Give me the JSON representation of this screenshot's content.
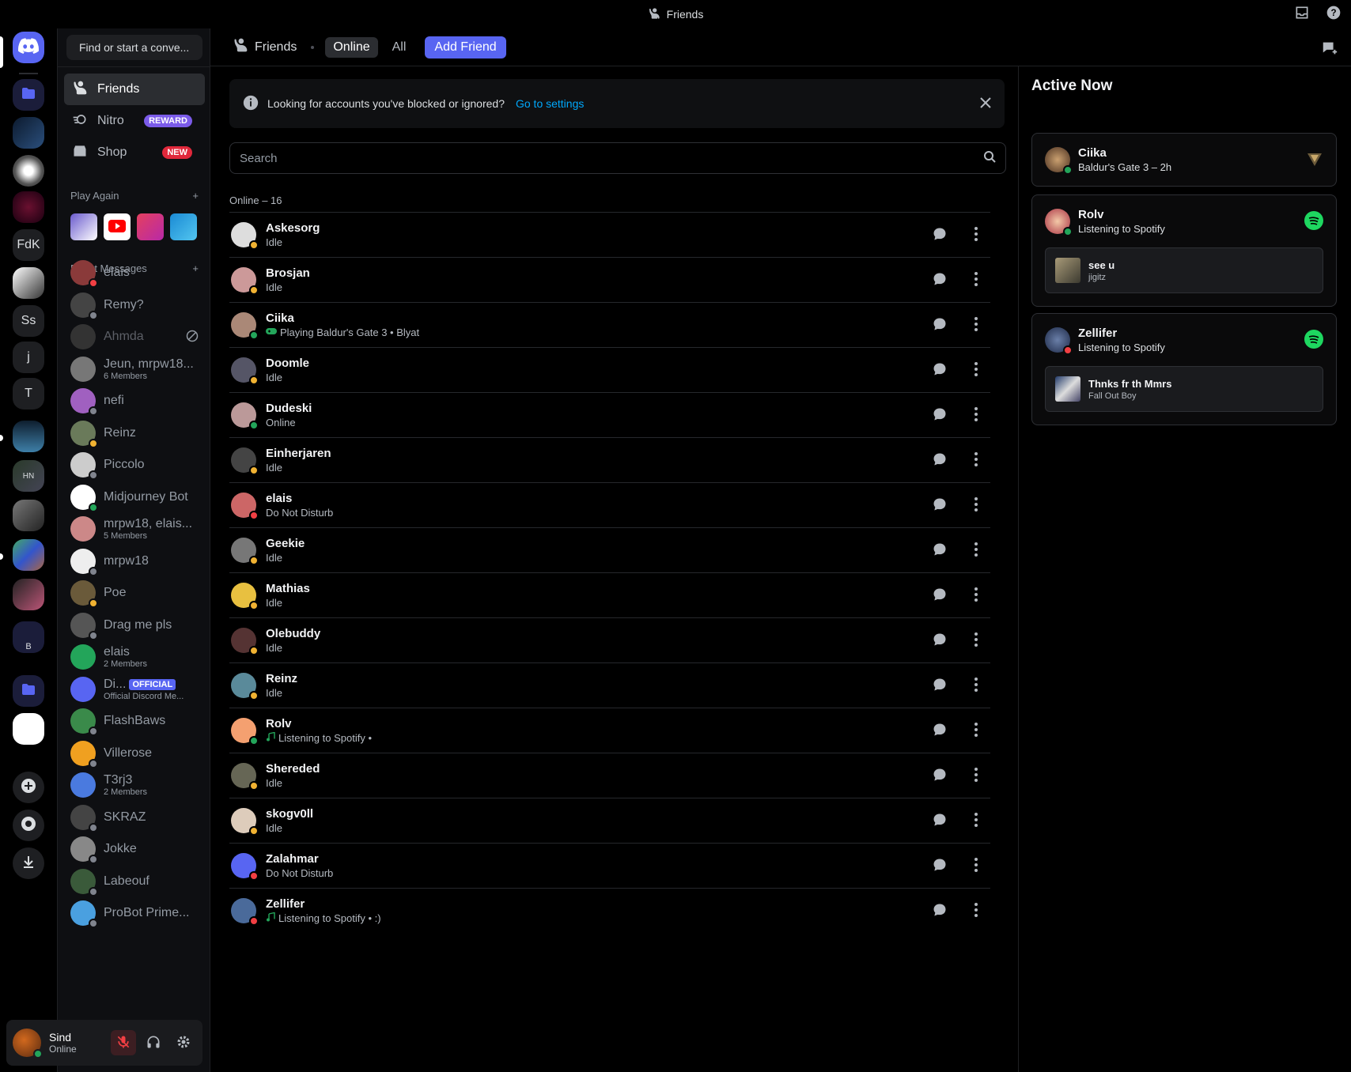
{
  "window": {
    "title": "Friends"
  },
  "servers": {
    "labels": [
      "FdK",
      "Ss",
      "j",
      "T",
      "HN",
      "B"
    ]
  },
  "sidebar": {
    "search_label": "Find or start a conve...",
    "nav": [
      {
        "label": "Friends"
      },
      {
        "label": "Nitro",
        "badge": "REWARD"
      },
      {
        "label": "Shop",
        "badge": "NEW"
      }
    ],
    "play_again_header": "Play Again",
    "direct_messages_header": "Direct Messages",
    "dms": [
      {
        "name": "elais",
        "status": "dnd"
      },
      {
        "name": "Remy?",
        "status": "offline"
      },
      {
        "name": "Ahmda",
        "status": "blocked"
      },
      {
        "name": "Jeun, mrpw18...",
        "sub": "6 Members"
      },
      {
        "name": "nefi",
        "status": "offline"
      },
      {
        "name": "Reinz",
        "status": "idle"
      },
      {
        "name": "Piccolo",
        "status": "offline"
      },
      {
        "name": "Midjourney Bot",
        "status": "online"
      },
      {
        "name": "mrpw18, elais...",
        "sub": "5 Members"
      },
      {
        "name": "mrpw18",
        "status": "offline"
      },
      {
        "name": "Poe",
        "status": "idle"
      },
      {
        "name": "Drag me pls",
        "status": "offline"
      },
      {
        "name": "elais",
        "sub": "2 Members"
      },
      {
        "name": "Di...",
        "badge": "OFFICIAL",
        "sub": "Official Discord Me..."
      },
      {
        "name": "FlashBaws",
        "status": "offline"
      },
      {
        "name": "Villerose",
        "status": "offline"
      },
      {
        "name": "T3rj3",
        "sub": "2 Members"
      },
      {
        "name": "SKRAZ",
        "status": "offline"
      },
      {
        "name": "Jokke",
        "status": "offline"
      },
      {
        "name": "Labeouf",
        "status": "offline"
      },
      {
        "name": "ProBot Prime...",
        "status": "offline"
      }
    ]
  },
  "user": {
    "name": "Sind",
    "status": "Online"
  },
  "header": {
    "title": "Friends",
    "tabs": [
      "Online",
      "All"
    ],
    "add_friend": "Add Friend"
  },
  "notice": {
    "text": "Looking for accounts you've blocked or ignored?",
    "link": "Go to settings"
  },
  "search": {
    "placeholder": "Search"
  },
  "online_count_label": "Online – 16",
  "friends": [
    {
      "name": "Askesorg",
      "status": "Idle",
      "st": "idle"
    },
    {
      "name": "Brosjan",
      "status": "Idle",
      "st": "idle"
    },
    {
      "name": "Ciika",
      "status": "Playing Baldur's Gate 3 • Blyat",
      "st": "online",
      "icon": "game"
    },
    {
      "name": "Doomle",
      "status": "Idle",
      "st": "idle"
    },
    {
      "name": "Dudeski",
      "status": "Online",
      "st": "online"
    },
    {
      "name": "Einherjaren",
      "status": "Idle",
      "st": "idle"
    },
    {
      "name": "elais",
      "status": "Do Not Disturb",
      "st": "dnd"
    },
    {
      "name": "Geekie",
      "status": "Idle",
      "st": "idle"
    },
    {
      "name": "Mathias",
      "status": "Idle",
      "st": "idle"
    },
    {
      "name": "Olebuddy",
      "status": "Idle",
      "st": "idle"
    },
    {
      "name": "Reinz",
      "status": "Idle",
      "st": "idle"
    },
    {
      "name": "Rolv",
      "status": "Listening to Spotify •",
      "st": "online",
      "icon": "music"
    },
    {
      "name": "Shereded",
      "status": "Idle",
      "st": "idle"
    },
    {
      "name": "skogv0ll",
      "status": "Idle",
      "st": "idle"
    },
    {
      "name": "Zalahmar",
      "status": "Do Not Disturb",
      "st": "dnd"
    },
    {
      "name": "Zellifer",
      "status": "Listening to Spotify • :)",
      "st": "dnd",
      "icon": "music"
    }
  ],
  "active_now": {
    "title": "Active Now",
    "cards": [
      {
        "name": "Ciika",
        "sub": "Baldur's Gate 3 – 2h"
      },
      {
        "name": "Rolv",
        "sub": "Listening to Spotify",
        "track": "see u",
        "artist": "jigitz"
      },
      {
        "name": "Zellifer",
        "sub": "Listening to Spotify",
        "track": "Thnks fr th Mmrs",
        "artist": "Fall Out Boy"
      }
    ]
  },
  "colors": {
    "accent": "#5865f2",
    "online": "#23a55a",
    "idle": "#f0b232",
    "dnd": "#f23f43",
    "offline": "#80848e",
    "spotify": "#1ed760",
    "link": "#00a8fc"
  }
}
